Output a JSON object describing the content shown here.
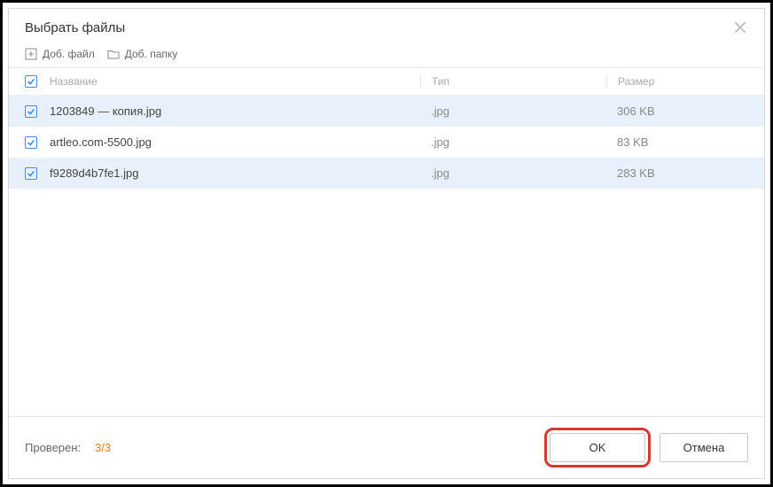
{
  "dialog": {
    "title": "Выбрать файлы"
  },
  "toolbar": {
    "add_file_label": "Доб. файл",
    "add_folder_label": "Доб. папку"
  },
  "columns": {
    "name": "Название",
    "type": "Тип",
    "size": "Размер"
  },
  "files": [
    {
      "name": "1203849 — копия.jpg",
      "type": ".jpg",
      "size": "306 KB",
      "checked": true
    },
    {
      "name": "artleo.com-5500.jpg",
      "type": ".jpg",
      "size": "83 KB",
      "checked": true
    },
    {
      "name": "f9289d4b7fe1.jpg",
      "type": ".jpg",
      "size": "283 KB",
      "checked": true
    }
  ],
  "footer": {
    "status_label": "Проверен:",
    "status_count": "3/3",
    "ok_label": "OK",
    "cancel_label": "Отмена"
  }
}
